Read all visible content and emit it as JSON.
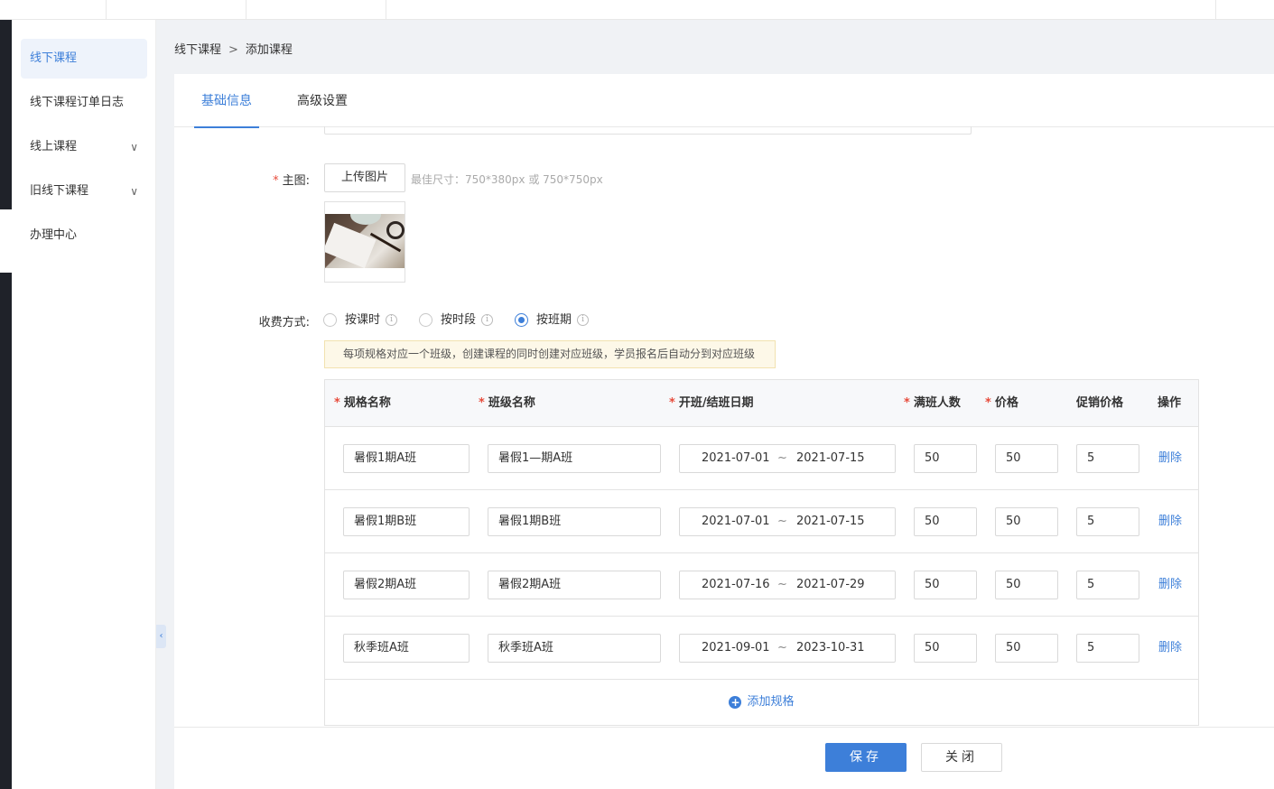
{
  "sidebar": {
    "items": [
      {
        "label": "线下课程"
      },
      {
        "label": "线下课程订单日志"
      },
      {
        "label": "线上课程",
        "chevron": "∨"
      },
      {
        "label": "旧线下课程",
        "chevron": "∨"
      },
      {
        "label": "办理中心"
      }
    ],
    "collapse_glyph": "‹"
  },
  "breadcrumb": {
    "parent": "线下课程",
    "separator": ">",
    "current": "添加课程"
  },
  "tabs": [
    {
      "label": "基础信息"
    },
    {
      "label": "高级设置"
    }
  ],
  "main_image": {
    "required": "*",
    "label": "主图:",
    "upload_label": "上传图片",
    "hint": "最佳尺寸：750*380px 或 750*750px"
  },
  "billing": {
    "label": "收费方式:",
    "info_glyph": "i",
    "options": [
      {
        "label": "按课时",
        "checked": false
      },
      {
        "label": "按时段",
        "checked": false
      },
      {
        "label": "按班期",
        "checked": true
      }
    ],
    "notice": "每项规格对应一个班级，创建课程的同时创建对应班级，学员报名后自动分到对应班级"
  },
  "spec_table": {
    "required": "*",
    "headers": {
      "spec_name": "规格名称",
      "class_name": "班级名称",
      "dates": "开班/结班日期",
      "capacity": "满班人数",
      "price": "价格",
      "promo_price": "促销价格",
      "actions": "操作"
    },
    "date_separator": "~",
    "delete_label": "删除",
    "rows": [
      {
        "spec_name": "暑假1期A班",
        "class_name": "暑假1—期A班",
        "start": "2021-07-01",
        "end": "2021-07-15",
        "capacity": "50",
        "price": "50",
        "promo_price": "5"
      },
      {
        "spec_name": "暑假1期B班",
        "class_name": "暑假1期B班",
        "start": "2021-07-01",
        "end": "2021-07-15",
        "capacity": "50",
        "price": "50",
        "promo_price": "5"
      },
      {
        "spec_name": "暑假2期A班",
        "class_name": "暑假2期A班",
        "start": "2021-07-16",
        "end": "2021-07-29",
        "capacity": "50",
        "price": "50",
        "promo_price": "5"
      },
      {
        "spec_name": "秋季班A班",
        "class_name": "秋季班A班",
        "start": "2021-09-01",
        "end": "2023-10-31",
        "capacity": "50",
        "price": "50",
        "promo_price": "5"
      }
    ],
    "add_label": "添加规格",
    "add_glyph": "+"
  },
  "footer": {
    "save_label": "保存",
    "close_label": "关闭"
  },
  "colors": {
    "accent": "#3d7fd9",
    "required": "#e74c3c",
    "notice_bg": "#fdf8e8"
  }
}
